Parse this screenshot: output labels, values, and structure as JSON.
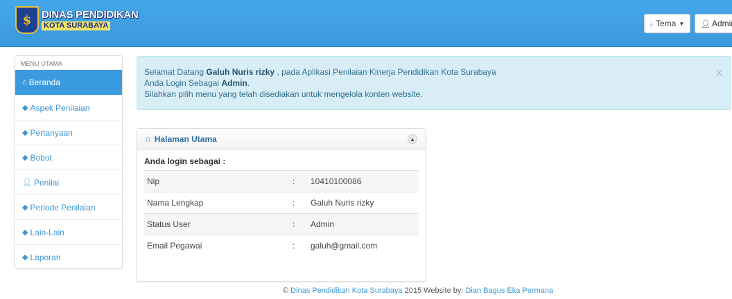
{
  "header": {
    "logo_line1": "DINAS PENDIDIKAN",
    "logo_line2": "KOTA SURABAYA",
    "theme_button": "Tema",
    "admin_button": "Admin"
  },
  "sidebar": {
    "heading": "MENU UTAMA",
    "items": [
      {
        "label": "Beranda",
        "icon": "home-icon"
      },
      {
        "label": "Aspek Penilaian",
        "icon": "tags-icon"
      },
      {
        "label": "Pertanyaan",
        "icon": "tags-icon"
      },
      {
        "label": "Bobot",
        "icon": "tags-icon"
      },
      {
        "label": "Penilai",
        "icon": "user-icon"
      },
      {
        "label": "Periode Penilaian",
        "icon": "tags-icon"
      },
      {
        "label": "Lain-Lain",
        "icon": "tags-icon"
      },
      {
        "label": "Laporan",
        "icon": "tags-icon"
      }
    ]
  },
  "alert": {
    "prefix": "Selamat Datang ",
    "user": "Galuh Nuris rizky",
    "suffix": " , pada Aplikasi Penilaian Kinerja Pendidikan Kota Surabaya",
    "line2_prefix": "Anda Login Sebagai ",
    "role": "Admin",
    "line2_suffix": ".",
    "line3": "Silahkan pilih menu yang telah disediakan untuk mengelola konten website.",
    "close": "X"
  },
  "panel": {
    "title": "Halaman Utama",
    "subtitle": "Anda login sebagai :",
    "rows": [
      {
        "label": "Nip",
        "sep": ":",
        "value": "10410100086"
      },
      {
        "label": "Nama Lengkap",
        "sep": ":",
        "value": "Galuh Nuris rizky"
      },
      {
        "label": "Status User",
        "sep": ":",
        "value": "Admin"
      },
      {
        "label": "Email Pegawai",
        "sep": ":",
        "value": "galuh@gmail.com"
      }
    ]
  },
  "footer": {
    "copyright": "© ",
    "org": "Dinas Pendidikan Kota Surabaya",
    "mid": " 2015 Website by: ",
    "author": "Dian Bagus Eka Permana"
  },
  "colors": {
    "navbar": "#3a98dc",
    "accent": "#3a97d6",
    "alert_bg": "#d9edf7"
  }
}
